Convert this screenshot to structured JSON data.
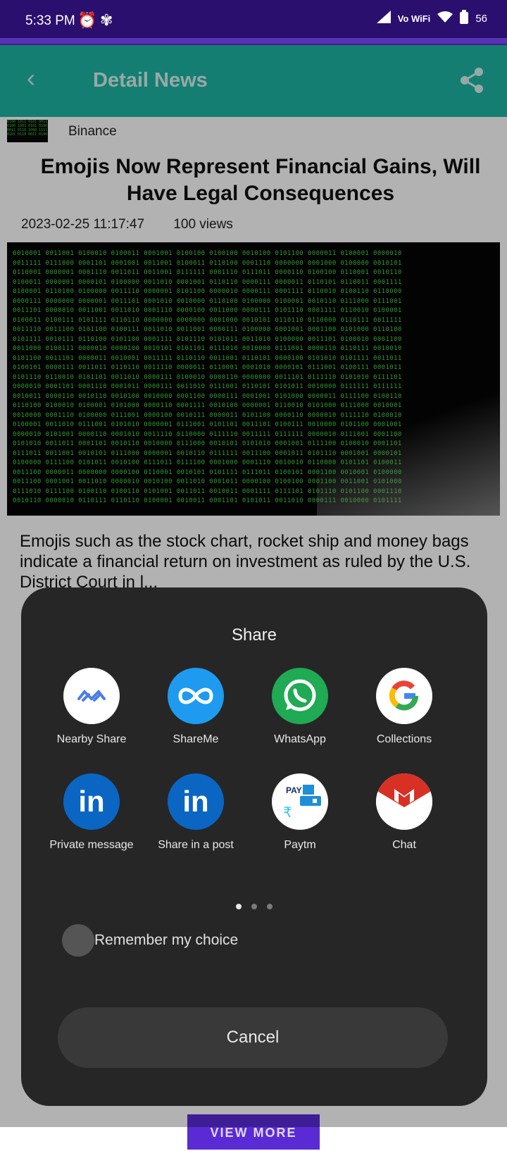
{
  "status_bar": {
    "time": "5:33 PM",
    "network": "Vo WiFi",
    "battery": "56",
    "alarm_icon": "alarm-clock-icon",
    "app_icon": "pinwheel-icon"
  },
  "app_bar": {
    "title": "Detail News",
    "back_icon": "back-arrow-icon",
    "share_icon": "share-icon",
    "color": "#1fb5a4"
  },
  "article": {
    "source": "Binance",
    "headline": "Emojis Now Represent Financial Gains, Will Have Legal Consequences",
    "date": "2023-02-25 11:17:47",
    "views": "100 views",
    "body": "Emojis such as the stock chart, rocket ship and money bags indicate a financial return on investment as ruled by the U.S. District Court in l...",
    "view_more": "VIEW MORE"
  },
  "share_sheet": {
    "title": "Share",
    "apps": [
      {
        "label": "Nearby Share",
        "icon": "nearby-share-icon",
        "color": "#ffffff"
      },
      {
        "label": "ShareMe",
        "icon": "shareme-icon",
        "color": "#1e9bf0"
      },
      {
        "label": "WhatsApp",
        "icon": "whatsapp-icon",
        "color": "#1faa53"
      },
      {
        "label": "Collections",
        "icon": "google-icon",
        "color": "#ffffff"
      },
      {
        "label": "Private message",
        "icon": "linkedin-icon",
        "color": "#0a66c2"
      },
      {
        "label": "Share in a post",
        "icon": "linkedin-icon",
        "color": "#0a66c2"
      },
      {
        "label": "Paytm",
        "icon": "paytm-icon",
        "color": "#ffffff"
      },
      {
        "label": "Chat",
        "icon": "gmail-icon",
        "color": "#ffffff"
      }
    ],
    "page_indicator": {
      "pages": 3,
      "active": 1
    },
    "remember_label": "Remember my choice",
    "cancel_label": "Cancel"
  }
}
